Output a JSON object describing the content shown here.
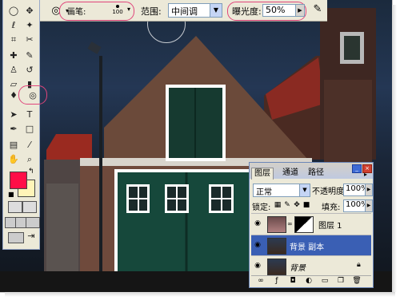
{
  "options_bar": {
    "tool_icon": "sponge-tool-icon",
    "brush_label": "画笔:",
    "brush_size": "100",
    "range_label": "范围:",
    "range_value": "中间调",
    "exposure_label": "曝光度:",
    "exposure_value": "50%",
    "airbrush_icon": "airbrush-icon"
  },
  "toolbox": {
    "tools": [
      "marquee-icon",
      "move-icon",
      "lasso-icon",
      "magic-wand-icon",
      "crop-icon",
      "slice-icon",
      "healing-brush-icon",
      "brush-icon",
      "clone-stamp-icon",
      "history-brush-icon",
      "eraser-icon",
      "gradient-icon",
      "blur-icon",
      "dodge-burn-sponge-icon",
      "path-selection-icon",
      "type-icon",
      "pen-icon",
      "shape-icon",
      "notes-icon",
      "eyedropper-icon",
      "hand-icon",
      "zoom-icon"
    ],
    "foreground_color": "#ff0e47",
    "background_color": "#fff4b8"
  },
  "layers_panel": {
    "tabs": [
      "图层",
      "通道",
      "路径"
    ],
    "blend_mode": "正常",
    "opacity_label": "不透明度:",
    "opacity_value": "100%",
    "lock_label": "锁定:",
    "fill_label": "填充:",
    "fill_value": "100%",
    "layers": [
      {
        "name": "图层 1",
        "selected": false
      },
      {
        "name": "背景 副本",
        "selected": true
      },
      {
        "name": "背景",
        "selected": false
      }
    ]
  }
}
